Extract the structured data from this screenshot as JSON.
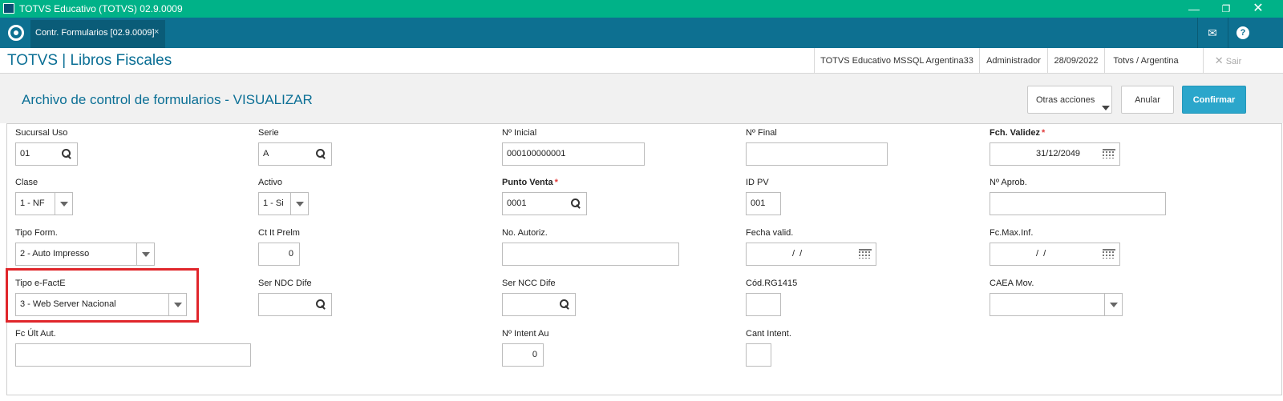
{
  "window": {
    "title": "TOTVS Educativo (TOTVS) 02.9.0009"
  },
  "tabbar": {
    "tab_label": "Contr. Formularios [02.9.0009]",
    "tab_close": "×"
  },
  "infobar": {
    "module_title": "TOTVS | Libros Fiscales",
    "environment": "TOTVS Educativo MSSQL Argentina33",
    "user": "Administrador",
    "date": "28/09/2022",
    "company": "Totvs / Argentina",
    "exit_label": "Sair"
  },
  "page": {
    "title": "Archivo de control de formularios - VISUALIZAR",
    "other_actions": "Otras acciones",
    "cancel": "Anular",
    "confirm": "Confirmar"
  },
  "form": {
    "sucursal_uso": {
      "label": "Sucursal Uso",
      "value": "01"
    },
    "serie": {
      "label": "Serie",
      "value": "A"
    },
    "n_inicial": {
      "label": "Nº Inicial",
      "value": "000100000001"
    },
    "n_final": {
      "label": "Nº Final",
      "value": ""
    },
    "fch_validez": {
      "label": "Fch. Validez",
      "value": "31/12/2049",
      "required": true
    },
    "clase": {
      "label": "Clase",
      "value": "1 - NF"
    },
    "activo": {
      "label": "Activo",
      "value": "1 - Si"
    },
    "punto_venta": {
      "label": "Punto Venta",
      "value": "0001",
      "required": true
    },
    "id_pv": {
      "label": "ID PV",
      "value": "001"
    },
    "n_aprob": {
      "label": "Nº Aprob.",
      "value": ""
    },
    "tipo_form": {
      "label": "Tipo Form.",
      "value": "2 - Auto Impresso"
    },
    "ct_it_prelm": {
      "label": "Ct It Prelm",
      "value": "0"
    },
    "no_autoriz": {
      "label": "No. Autoriz.",
      "value": ""
    },
    "fecha_valid": {
      "label": "Fecha valid.",
      "value": "/  /"
    },
    "fc_max_inf": {
      "label": "Fc.Max.Inf.",
      "value": "/  /"
    },
    "tipo_efacte": {
      "label": "Tipo e-FactE",
      "value": "3 - Web Server Nacional"
    },
    "ser_ndc_dife": {
      "label": "Ser NDC Dife",
      "value": ""
    },
    "ser_ncc_dife": {
      "label": "Ser NCC Dife",
      "value": ""
    },
    "cod_rg1415": {
      "label": "Cód.RG1415",
      "value": ""
    },
    "caea_mov": {
      "label": "CAEA Mov.",
      "value": ""
    },
    "fc_ult_aut": {
      "label": "Fc Últ Aut.",
      "value": ""
    },
    "n_intent_au": {
      "label": "Nº Intent Au",
      "value": "0"
    },
    "cant_intent": {
      "label": "Cant Intent.",
      "value": ""
    }
  },
  "colors": {
    "titlebar": "#00b288",
    "tabbar": "#0d7091",
    "accent": "#0b6f95",
    "confirm": "#2ba6cb",
    "highlight": "#e0262b",
    "required_star": "#e03a3a"
  }
}
